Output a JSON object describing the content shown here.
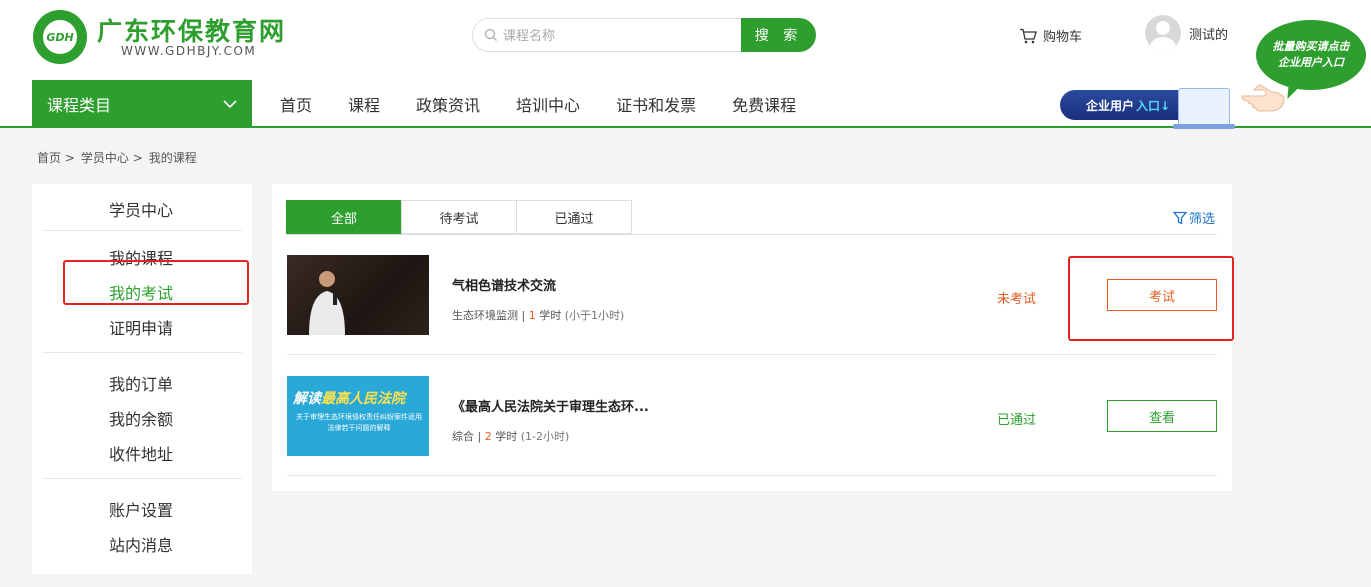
{
  "header": {
    "logo_title": "广东环保教育网",
    "logo_subtitle": "WWW.GDHBJY.COM",
    "logo_mark": "GDH",
    "search_placeholder": "课程名称",
    "search_button": "搜 索",
    "cart_label": "购物车",
    "username": "测试的",
    "promo_line1": "批量购买请点击",
    "promo_line2": "企业用户入口",
    "enterprise_label": "企业用户",
    "enterprise_highlight": "入口↓"
  },
  "nav": {
    "category_label": "课程类目",
    "items": [
      "首页",
      "课程",
      "政策资讯",
      "培训中心",
      "证书和发票",
      "免费课程"
    ]
  },
  "breadcrumb": [
    "首页 >",
    "学员中心 >",
    "我的课程"
  ],
  "sidebar": {
    "title": "学员中心",
    "items": [
      "我的课程",
      "我的考试",
      "证明申请",
      "我的订单",
      "我的余额",
      "收件地址",
      "账户设置",
      "站内消息"
    ],
    "active": "我的考试"
  },
  "tabs": [
    "全部",
    "待考试",
    "已通过"
  ],
  "filter_label": "筛选",
  "courses": [
    {
      "title": "气相色谱技术交流",
      "category": "生态环境监测",
      "hours": "1",
      "hours_unit": "学时",
      "duration_note": "(小于1小时)",
      "status": "未考试",
      "action": "考试"
    },
    {
      "title": "《最高人民法院关于审理生态环...",
      "category": "综合",
      "hours": "2",
      "hours_unit": "学时",
      "duration_note": "(1-2小时)",
      "status": "已通过",
      "action": "查看",
      "thumb_title_1": "解读",
      "thumb_title_2": "最高人民法院",
      "thumb_subtitle": "关于审理生态环境侵权责任纠纷案件适用法律若干问题的解释"
    }
  ],
  "colors": {
    "brand_green": "#2e9f2e",
    "pending_orange": "#e05a22",
    "highlight_red": "#e52222",
    "link_blue": "#1a73c9"
  }
}
